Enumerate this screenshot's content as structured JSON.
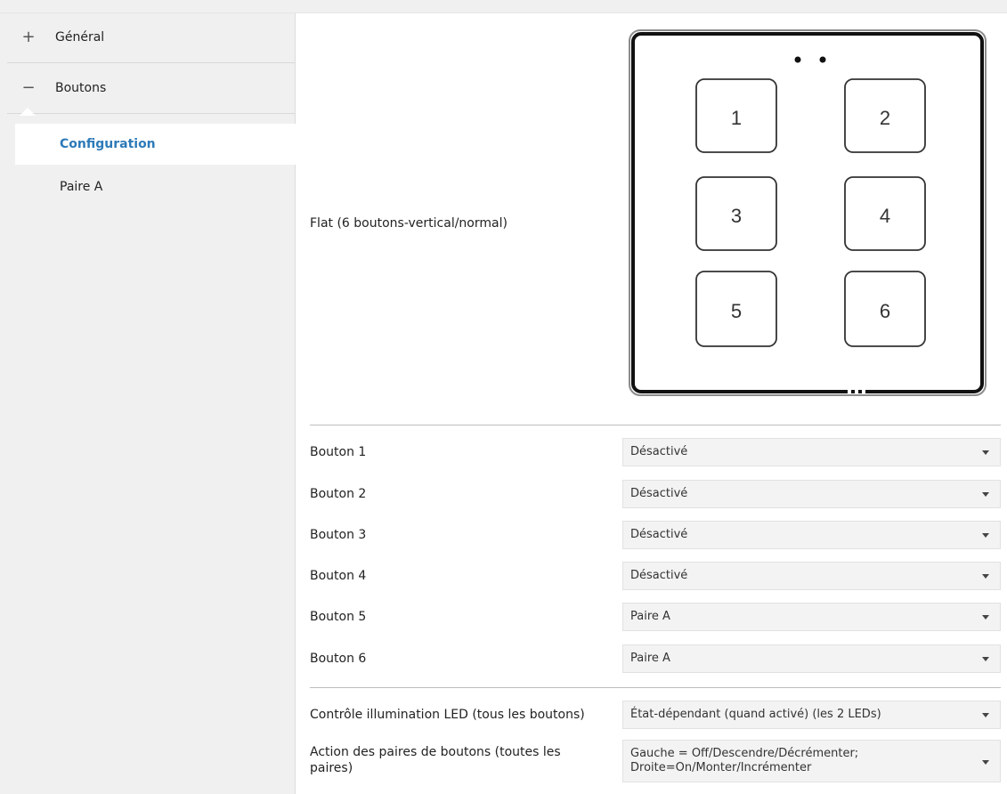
{
  "sidebar": {
    "groups": [
      {
        "sign": "+",
        "label": "Général"
      },
      {
        "sign": "−",
        "label": "Boutons"
      }
    ],
    "subitems": [
      {
        "label": "Configuration",
        "active": true
      },
      {
        "label": "Paire A",
        "active": false
      }
    ]
  },
  "main": {
    "image_label": "Flat (6 boutons-vertical/normal)",
    "device_buttons": [
      "1",
      "2",
      "3",
      "4",
      "5",
      "6"
    ],
    "buttons": [
      {
        "label": "Bouton 1",
        "value": "Désactivé"
      },
      {
        "label": "Bouton 2",
        "value": "Désactivé"
      },
      {
        "label": "Bouton 3",
        "value": "Désactivé"
      },
      {
        "label": "Bouton 4",
        "value": "Désactivé"
      },
      {
        "label": "Bouton 5",
        "value": "Paire A"
      },
      {
        "label": "Bouton 6",
        "value": "Paire A"
      }
    ],
    "led": {
      "label": "Contrôle illumination LED (tous les boutons)",
      "value": "État-dépendant (quand activé) (les 2 LEDs)"
    },
    "pairs": {
      "label_line1": "Action des paires de boutons (toutes les",
      "label_line2": "paires)",
      "value_line1": "Gauche = Off/Descendre/Décrémenter;",
      "value_line2": "Droite=On/Monter/Incrémenter"
    }
  }
}
